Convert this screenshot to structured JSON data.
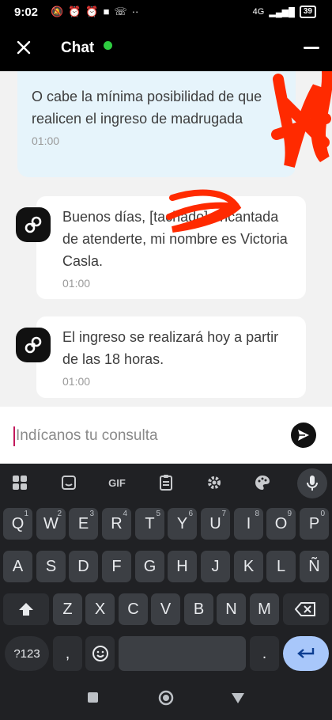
{
  "status_bar": {
    "time": "9:02",
    "network": "4G",
    "battery": "39"
  },
  "header": {
    "title": "Chat",
    "status_color": "#2ecc40"
  },
  "messages": [
    {
      "sender": "user",
      "text": "O cabe la mínima posibilidad de que realicen el ingreso de madrugada",
      "time": "01:00"
    },
    {
      "sender": "bot",
      "text": "Buenos días, [tachado] encantada de atenderte, mi nombre es Victoria Casla.",
      "time": "01:00"
    },
    {
      "sender": "bot",
      "text": "El ingreso se realizará hoy a partir de las 18 horas.",
      "time": "01:00"
    }
  ],
  "composer": {
    "placeholder": "Indícanos tu consulta"
  },
  "keyboard": {
    "toolbar": [
      "apps-icon",
      "sticker-icon",
      "GIF",
      "clipboard-icon",
      "settings-icon",
      "palette-icon",
      "mic-icon"
    ],
    "row1": [
      "Q",
      "W",
      "E",
      "R",
      "T",
      "Y",
      "U",
      "I",
      "O",
      "P"
    ],
    "row1_hints": [
      "1",
      "2",
      "3",
      "4",
      "5",
      "6",
      "7",
      "8",
      "9",
      "0"
    ],
    "row2": [
      "A",
      "S",
      "D",
      "F",
      "G",
      "H",
      "J",
      "K",
      "L",
      "Ñ"
    ],
    "row3": [
      "Z",
      "X",
      "C",
      "V",
      "B",
      "N",
      "M"
    ],
    "symbols_label": "?123",
    "comma": ",",
    "period": "."
  }
}
